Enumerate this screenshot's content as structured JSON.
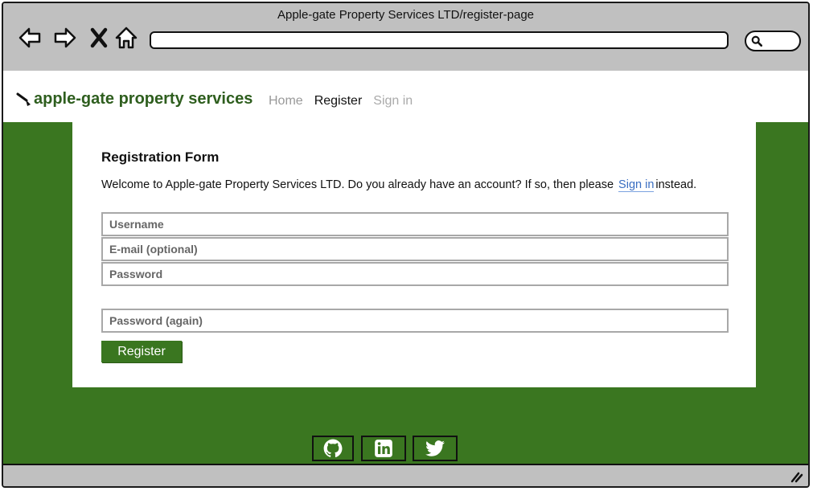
{
  "window": {
    "title": "Apple-gate Property Services LTD/register-page"
  },
  "browser": {
    "back_icon": "arrow-left-icon",
    "forward_icon": "arrow-right-icon",
    "stop_icon": "close-icon",
    "home_icon": "home-icon",
    "search_icon": "magnifier-icon"
  },
  "navbar": {
    "brand": "apple-gate property services",
    "links": [
      "Home",
      "Register",
      "Sign in"
    ]
  },
  "form": {
    "title": "Registration Form",
    "welcome_prefix": "Welcome to Apple-gate Property Services LTD. Do you already have an account? If so, then please",
    "welcome_link": "Sign in",
    "welcome_suffix": "instead.",
    "fields": {
      "username": "Username",
      "email": "E-mail (optional)",
      "password": "Password",
      "password_again": "Password (again)"
    },
    "submit_label": "Register"
  },
  "footer": {
    "socials": [
      "github-icon",
      "linkedin-icon",
      "twitter-icon"
    ]
  },
  "colors": {
    "brand_green": "#3a7620",
    "link_blue": "#3a6ec2"
  }
}
